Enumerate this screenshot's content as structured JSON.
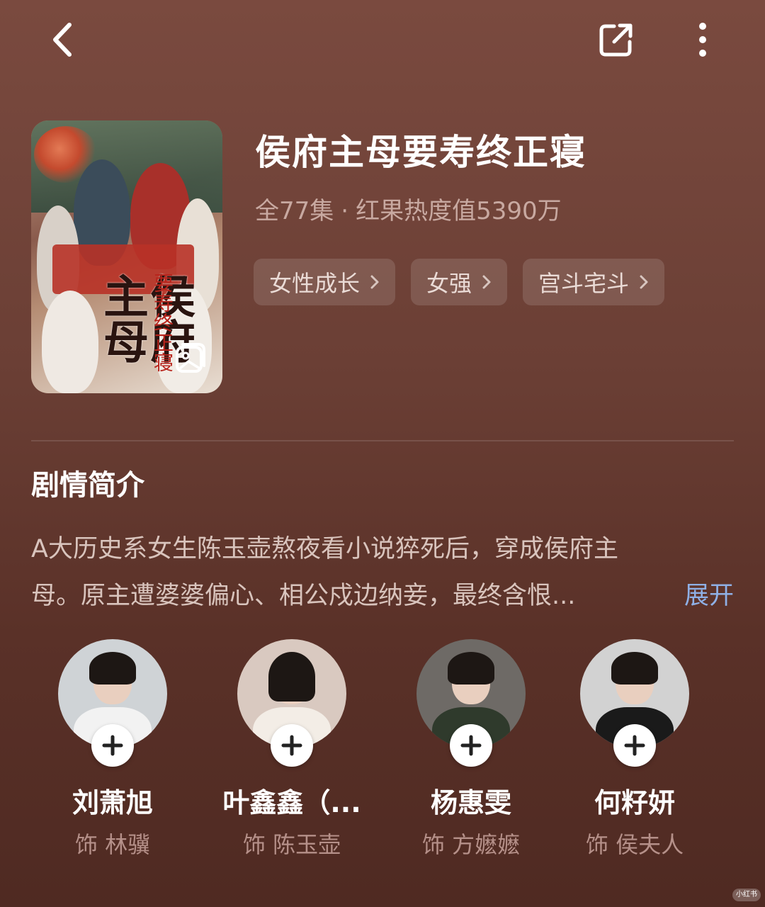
{
  "header": {
    "back_icon": "chevron-left-icon",
    "share_icon": "share-icon",
    "more_icon": "more-vertical-icon"
  },
  "drama": {
    "title": "侯府主母要寿终正寝",
    "episodes": "全77集",
    "separator": "·",
    "heat": "红果热度值5390万",
    "poster_calligraphy": "侯府主母",
    "poster_subtitle": "要寿终正寝",
    "tags": [
      {
        "label": "女性成长"
      },
      {
        "label": "女强"
      },
      {
        "label": "宫斗宅斗"
      }
    ]
  },
  "synopsis": {
    "heading": "剧情简介",
    "line1": "A大历史系女生陈玉壶熬夜看小说猝死后，穿成侯府主",
    "line2": "母。原主遭婆婆偏心、相公戍边纳妾，最终含恨...",
    "expand_label": "展开"
  },
  "cast": [
    {
      "name": "刘萧旭",
      "role": "饰 林骥",
      "bg": "#cfd3d6",
      "outfit": "#f2f2f2"
    },
    {
      "name": "叶鑫鑫（...",
      "role": "饰 陈玉壶",
      "bg": "#d9c9c0",
      "outfit": "#f3ede6"
    },
    {
      "name": "杨惠雯",
      "role": "饰 方嬷嬷",
      "bg": "#6e6a66",
      "outfit": "#2f3a2c"
    },
    {
      "name": "何籽妍",
      "role": "饰 侯夫人",
      "bg": "#d2d2d2",
      "outfit": "#1a1a1a"
    }
  ],
  "watermark": "小红书"
}
